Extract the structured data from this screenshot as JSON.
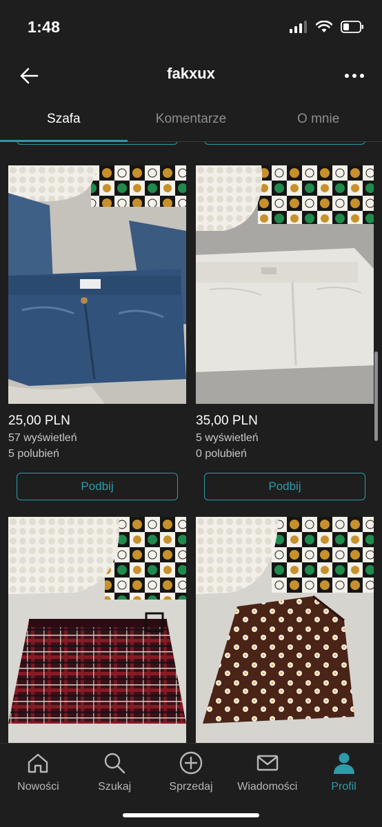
{
  "status_bar": {
    "time": "1:48"
  },
  "header": {
    "title": "fakxux"
  },
  "tabs": [
    {
      "label": "Szafa",
      "active": true
    },
    {
      "label": "Komentarze",
      "active": false
    },
    {
      "label": "O mnie",
      "active": false
    }
  ],
  "items": [
    {
      "price": "25,00 PLN",
      "views": "57 wyświetleń",
      "likes": "5 polubień",
      "button": "Podbij",
      "image": "blue-jeans"
    },
    {
      "price": "35,00 PLN",
      "views": "5 wyświetleń",
      "likes": "0 polubień",
      "button": "Podbij",
      "image": "white-jeans"
    },
    {
      "image": "plaid-skirt"
    },
    {
      "image": "floral-skirt"
    }
  ],
  "bottom_nav": [
    {
      "label": "Nowości",
      "icon": "home-icon",
      "active": false
    },
    {
      "label": "Szukaj",
      "icon": "search-icon",
      "active": false
    },
    {
      "label": "Sprzedaj",
      "icon": "plus-circle-icon",
      "active": false
    },
    {
      "label": "Wiadomości",
      "icon": "mail-icon",
      "active": false
    },
    {
      "label": "Profil",
      "icon": "person-icon",
      "active": true
    }
  ],
  "colors": {
    "accent": "#2f9ba8",
    "background": "#1e1e1e"
  }
}
